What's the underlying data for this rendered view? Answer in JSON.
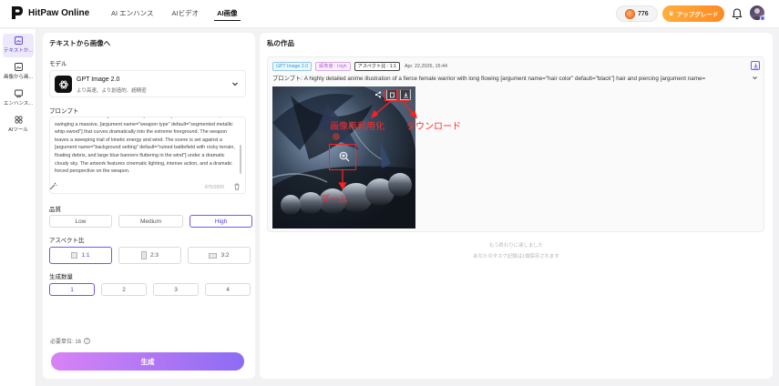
{
  "header": {
    "brand": "HitPaw Online",
    "nav": [
      "AI エンハンス",
      "AIビデオ",
      "AI画像"
    ],
    "credits": "776",
    "upgrade_label": "アップグレード"
  },
  "rail": {
    "items": [
      "テキストか...",
      "画像から画...",
      "エンハンス...",
      "AIツール"
    ]
  },
  "panel": {
    "title": "テキストから画像へ",
    "model_label": "モデル",
    "model_name": "GPT Image 2.0",
    "model_desc": "より高速、より創造的、超精密",
    "prompt_label": "プロンプト",
    "prompt_text": "default=\"blue and white\"] tunic. She is captured in a dynamic combat stance, swinging a massive, [argument name=\"weapon type\" default=\"segmented metallic whip-sword\"] that curves dramatically into the extreme foreground. The weapon leaves a sweeping trail of kinetic energy and wind. The scene is set against a [argument name=\"background setting\" default=\"ruined battlefield with rocky terrain, floating debris, and large blue banners fluttering in the wind\"] under a dramatic cloudy sky. The artwork features cinematic lighting, intense action, and a dramatic forced perspective on the weapon.",
    "char_count": "875/2000",
    "quality_label": "品質",
    "quality_options": [
      "Low",
      "Medium",
      "High"
    ],
    "quality_selected": "High",
    "aspect_label": "アスペクト比",
    "aspect_options": [
      "1:1",
      "2:3",
      "3:2"
    ],
    "aspect_selected": "1:1",
    "count_label": "生成数量",
    "count_options": [
      "1",
      "2",
      "3",
      "4"
    ],
    "count_selected": "1",
    "cost_label": "必要単位: 16",
    "generate_label": "生成"
  },
  "works": {
    "title": "私の作品",
    "tag_model": "GPT Image 2.0",
    "tag_resolution": "解像度 : High",
    "tag_aspect": "アスペクト比 : 1:1",
    "date": "Apr. 22,2026, 15:44",
    "prompt": "プロンプト: A highly detailed anime illustration of a fierce female warrior with long flowing [argument name=\"hair color\" default=\"black\"] hair and piercing [argument name=",
    "annot_top": "画像再利用化",
    "annot_download": "ダウンロード",
    "annot_zoom": "ズーム",
    "end_note_1": "もう終わりに達しました",
    "end_note_2": "あなたのタスク記録は1個保存されます"
  },
  "colors": {
    "accent": "#6a5cf0",
    "upgrade": "#ff8a23",
    "annotation": "#ff2020"
  }
}
